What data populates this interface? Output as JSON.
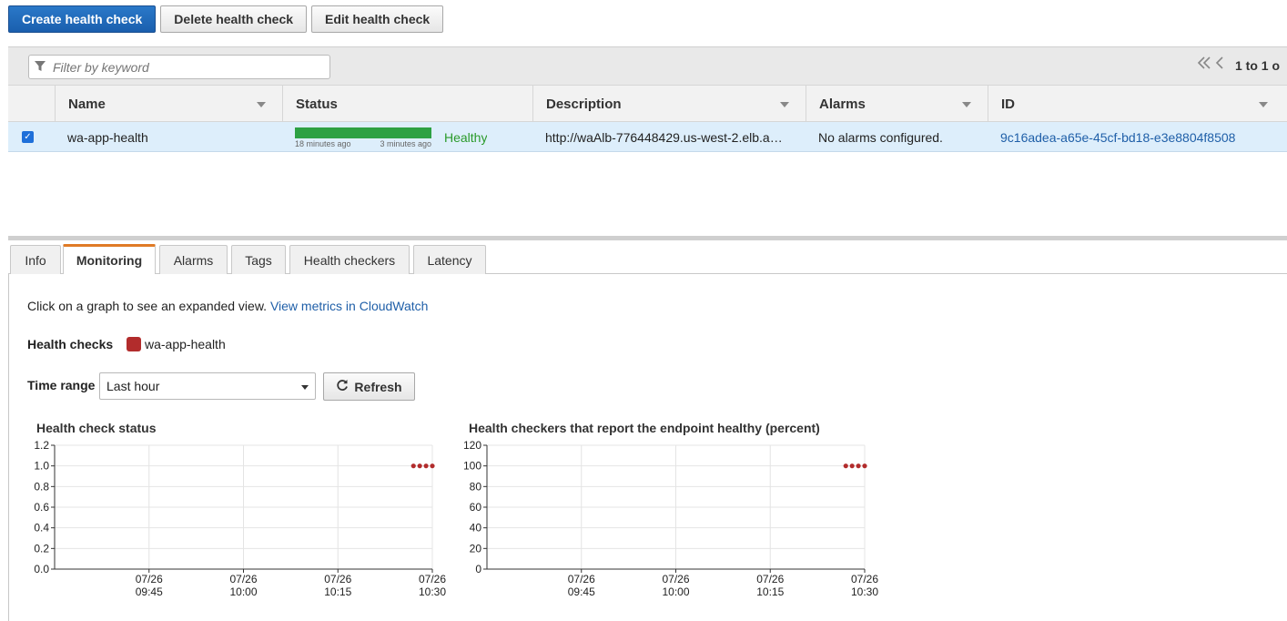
{
  "toolbar": {
    "create": "Create health check",
    "delete": "Delete health check",
    "edit": "Edit health check"
  },
  "filter": {
    "placeholder": "Filter by keyword"
  },
  "pager": {
    "text": "1 to 1 o"
  },
  "columns": {
    "name": "Name",
    "status": "Status",
    "description": "Description",
    "alarms": "Alarms",
    "id": "ID"
  },
  "row": {
    "name": "wa-app-health",
    "status_time_left": "18 minutes ago",
    "status_time_right": "3 minutes ago",
    "status": "Healthy",
    "description": "http://waAlb-776448429.us-west-2.elb.a…",
    "alarms": "No alarms configured.",
    "id": "9c16adea-a65e-45cf-bd18-e3e8804f8508",
    "status_color": "#2da143"
  },
  "tabs": {
    "info": "Info",
    "monitoring": "Monitoring",
    "alarms": "Alarms",
    "tags": "Tags",
    "health_checkers": "Health checkers",
    "latency": "Latency",
    "active": "Monitoring"
  },
  "monitoring": {
    "hint": "Click on a graph to see an expanded view.",
    "cloudwatch_link": "View metrics in CloudWatch",
    "health_checks_label": "Health checks",
    "legend_name": "wa-app-health",
    "legend_color": "#b22c2c",
    "time_range_label": "Time range",
    "time_range_value": "Last hour",
    "refresh_label": "Refresh"
  },
  "chart_data": [
    {
      "type": "scatter",
      "title": "Health check status",
      "xlabel": "",
      "ylabel": "",
      "ylim": [
        0,
        1.2
      ],
      "yticks": [
        "0.0",
        "0.2",
        "0.4",
        "0.6",
        "0.8",
        "1.0",
        "1.2"
      ],
      "xticks": [
        [
          "07/26",
          "09:45"
        ],
        [
          "07/26",
          "10:00"
        ],
        [
          "07/26",
          "10:15"
        ],
        [
          "07/26",
          "10:30"
        ]
      ],
      "xlim_minutes": [
        -15,
        45
      ],
      "series": [
        {
          "color": "#b22c2c",
          "x_minutes": [
            42,
            43,
            44,
            45
          ],
          "values": [
            1,
            1,
            1,
            1
          ]
        }
      ]
    },
    {
      "type": "scatter",
      "title": "Health checkers that report the endpoint healthy (percent)",
      "xlabel": "",
      "ylabel": "",
      "ylim": [
        0,
        120
      ],
      "yticks": [
        "0",
        "20",
        "40",
        "60",
        "80",
        "100",
        "120"
      ],
      "xticks": [
        [
          "07/26",
          "09:45"
        ],
        [
          "07/26",
          "10:00"
        ],
        [
          "07/26",
          "10:15"
        ],
        [
          "07/26",
          "10:30"
        ]
      ],
      "xlim_minutes": [
        -15,
        45
      ],
      "series": [
        {
          "color": "#b22c2c",
          "x_minutes": [
            42,
            43,
            44,
            45
          ],
          "values": [
            100,
            100,
            100,
            100
          ]
        }
      ]
    }
  ]
}
